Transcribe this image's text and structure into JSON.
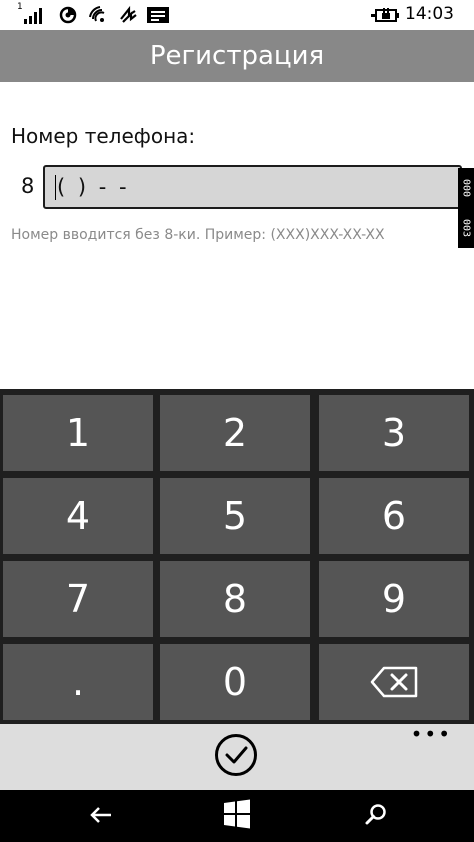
{
  "status_bar": {
    "time": "14:03",
    "signal_superscript": "1",
    "icons": [
      "signal-bars-icon",
      "data-sense-icon",
      "wifi-icon",
      "nfc-icon",
      "message-icon",
      "battery-charging-icon"
    ]
  },
  "header": {
    "title": "Регистрация"
  },
  "form": {
    "phone_label": "Номер телефона:",
    "prefix": "8",
    "phone_mask": "(  )  -  -",
    "hint": "Номер вводится без 8-ки. Пример: (XXX)XXX-XX-XX",
    "side_counter": [
      "000",
      "003"
    ]
  },
  "keypad": {
    "keys": [
      "1",
      "2",
      "3",
      "4",
      "5",
      "6",
      "7",
      "8",
      "9",
      ".",
      "0"
    ],
    "backspace_icon": "backspace-icon"
  },
  "app_bar": {
    "accept_icon": "checkmark-circle-icon",
    "more_label": "•••"
  },
  "nav_bar": {
    "icons": [
      "back-arrow-icon",
      "windows-start-icon",
      "search-icon"
    ]
  },
  "colors": {
    "header_bg": "#888888",
    "key_bg": "#555555",
    "keypad_bg": "#1f1f1f",
    "input_bg": "#d6d6d6",
    "app_bar_bg": "#dddddd",
    "hint_text": "#8a8a8a"
  }
}
